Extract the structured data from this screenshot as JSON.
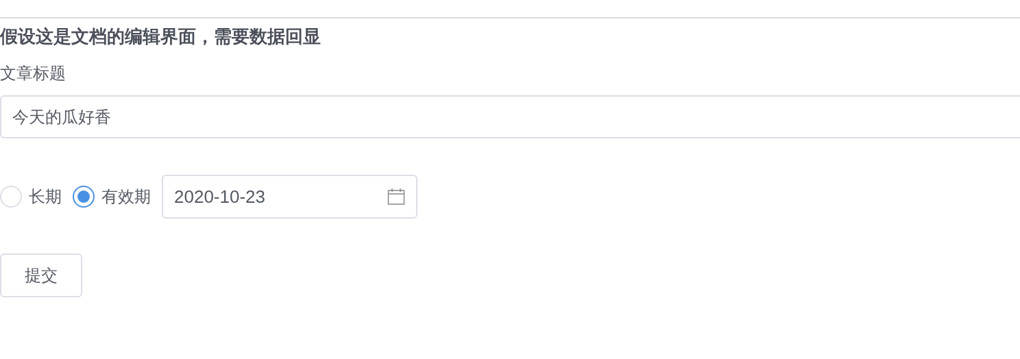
{
  "heading": "假设这是文档的编辑界面，需要数据回显",
  "title_field": {
    "label": "文章标题",
    "value": "今天的瓜好香"
  },
  "validity": {
    "options": [
      {
        "label": "长期",
        "selected": false
      },
      {
        "label": "有效期",
        "selected": true
      }
    ],
    "date": "2020-10-23"
  },
  "submit_button": "提交"
}
